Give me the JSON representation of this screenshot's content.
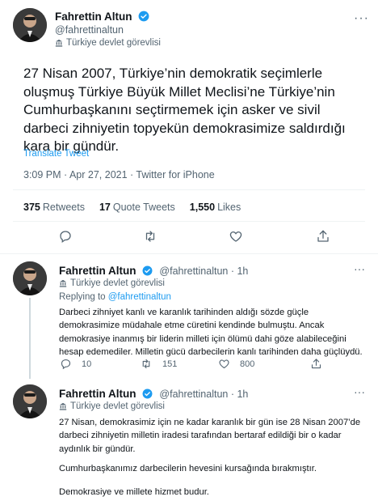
{
  "tweet": {
    "author_name": "Fahrettin Altun",
    "author_handle": "@fahrettinaltun",
    "gov_label": "Türkiye devlet görevlisi",
    "text": "27 Nisan 2007, Türkiye’nin demokratik seçimlerle oluşmuş Türkiye Büyük Millet Meclisi’ne Türkiye’nin Cumhurbaşkanını seçtirmemek için asker ve sivil darbeci zihniyetin topyekün demokrasimize saldırdığı kara bir gündür.",
    "translate": "Translate Tweet",
    "timestamp": "3:09 PM · Apr 27, 2021 · Twitter for iPhone",
    "retweets_count": "375",
    "retweets_label": "Retweets",
    "quotes_count": "17",
    "quotes_label": "Quote Tweets",
    "likes_count": "1,550",
    "likes_label": "Likes",
    "more_icon": "ellipsis-icon"
  },
  "reply1": {
    "author_name": "Fahrettin Altun",
    "author_handle": "@fahrettinaltun · 1h",
    "gov_label": "Türkiye devlet görevlisi",
    "replying_prefix": "Replying to",
    "replying_to": "@fahrettinaltun",
    "text": "Darbeci zihniyet kanlı ve karanlık tarihinden aldığı sözde güçle demokrasimize müdahale etme cüretini kendinde bulmuştu. Ancak demokrasiye inanmış bir liderin milleti için ölümü dahi göze alabileceğini hesap edemediler. Milletin gücü darbecilerin kanlı tarihinden daha güçlüydü.",
    "reply_count": "10",
    "retweet_count": "151",
    "like_count": "800"
  },
  "reply2": {
    "author_name": "Fahrettin Altun",
    "author_handle": "@fahrettinaltun · 1h",
    "gov_label": "Türkiye devlet görevlisi",
    "para1": "27 Nisan, demokrasimiz için ne kadar karanlık bir gün ise 28 Nisan 2007’de darbeci zihniyetin milletin iradesi tarafından bertaraf edildiği bir o kadar aydınlık bir gündür.",
    "para2": "Cumhurbaşkanımız darbecilerin hevesini kursağında bırakmıştır.",
    "para3": "Demokrasiye ve millete hizmet budur."
  },
  "colors": {
    "accent": "#1d9bf0",
    "verified": "#1d9bf0",
    "muted": "#536471",
    "divider": "#eff3f4"
  }
}
